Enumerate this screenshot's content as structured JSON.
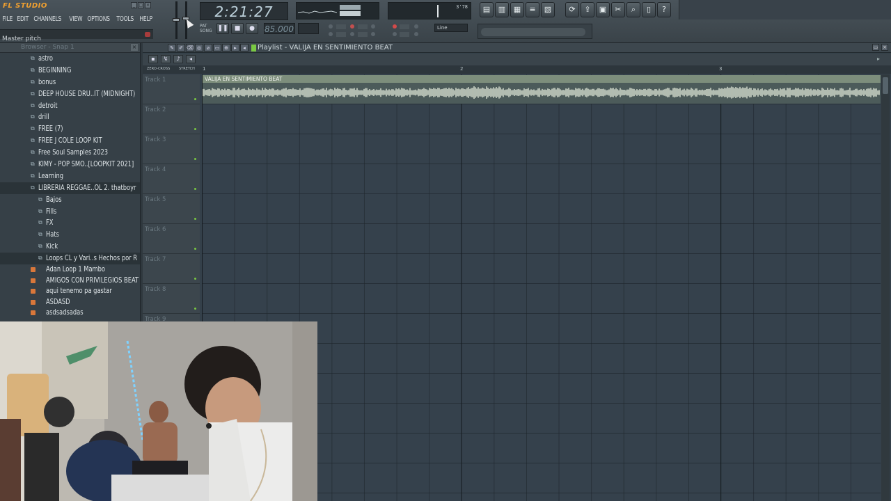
{
  "app": {
    "logo": "FL STUDIO",
    "menu": [
      "FILE",
      "EDIT",
      "CHANNELS",
      "VIEW",
      "OPTIONS",
      "TOOLS",
      "HELP"
    ],
    "hint": "Master pitch"
  },
  "transport": {
    "time": "2:21:27",
    "tempo": "85.000",
    "snap": "Line",
    "cpu_readout": "3'78"
  },
  "browser": {
    "title": "Browser - Snap 1",
    "folders": [
      {
        "label": "astro",
        "level": 0
      },
      {
        "label": "BEGINNING",
        "level": 0
      },
      {
        "label": "bonus",
        "level": 0
      },
      {
        "label": "DEEP HOUSE DRU..IT (MIDNIGHT)",
        "level": 0
      },
      {
        "label": "detroit",
        "level": 0
      },
      {
        "label": "drill",
        "level": 0
      },
      {
        "label": "FREE (7)",
        "level": 0
      },
      {
        "label": "FREE J COLE LOOP KIT",
        "level": 0
      },
      {
        "label": "Free Soul Samples 2023",
        "level": 0
      },
      {
        "label": "KIMY - POP SMO..[LOOPKIT 2021]",
        "level": 0
      },
      {
        "label": "Learning",
        "level": 0
      },
      {
        "label": "LIBRERIA REGGAE..OL 2. thatboyr",
        "level": 0
      },
      {
        "label": "Bajos",
        "level": 1
      },
      {
        "label": "Fills",
        "level": 1
      },
      {
        "label": "FX",
        "level": 1
      },
      {
        "label": "Hats",
        "level": 1
      },
      {
        "label": "Kick",
        "level": 1
      },
      {
        "label": "Loops CL y Vari..s Hechos por R",
        "level": 1
      }
    ],
    "files": [
      "Adan Loop 1 Mambo",
      "AMIGOS CON PRIVILEGIOS BEAT",
      "aqui tenemo pa gastar",
      "ASDASD",
      "asdsadsadas"
    ]
  },
  "playlist": {
    "title": "Playlist - VALIJA EN SENTIMIENTO  BEAT",
    "header_labels": [
      "ZERO-CROSS",
      "STRETCH"
    ],
    "bars": [
      "1",
      "2",
      "3"
    ],
    "tracks": [
      "Track 1",
      "Track 2",
      "Track 3",
      "Track 4",
      "Track 5",
      "Track 6",
      "Track 7",
      "Track 8",
      "Track 9"
    ],
    "clip_label": "VALIJA EN SENTIMIENTO  BEAT"
  }
}
